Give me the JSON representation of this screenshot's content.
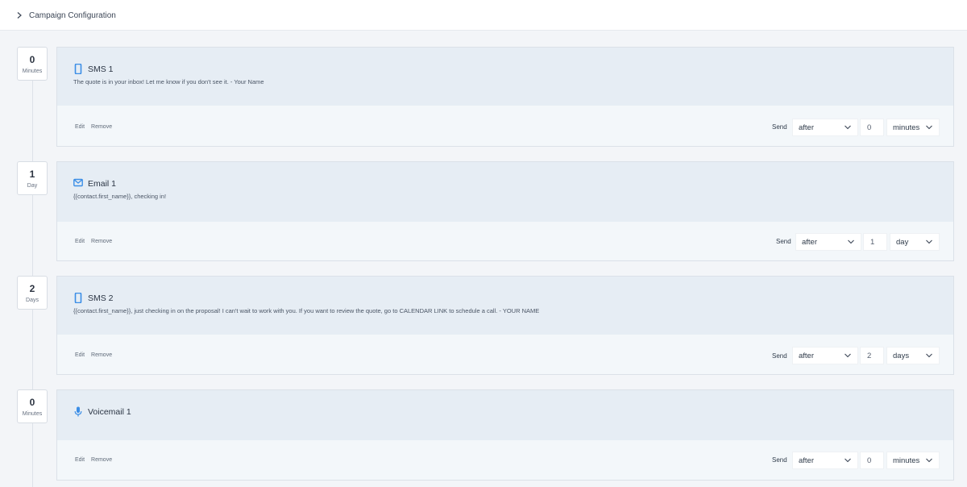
{
  "header": {
    "title": "Campaign Configuration"
  },
  "steps": [
    {
      "delay_value": "0",
      "delay_unit": "Minutes",
      "type_icon": "phone-icon",
      "name": "SMS 1",
      "message": "The quote is in your inbox! Let me know if you don't see it.   - Your Name",
      "edit_label": "Edit",
      "remove_label": "Remove",
      "send_label": "Send",
      "when": "after",
      "amount": "0",
      "unit": "minutes"
    },
    {
      "delay_value": "1",
      "delay_unit": "Day",
      "type_icon": "envelope-icon",
      "name": "Email 1",
      "message": "{{contact.first_name}}, checking in!",
      "edit_label": "Edit",
      "remove_label": "Remove",
      "send_label": "Send",
      "when": "after",
      "amount": "1",
      "unit": "day"
    },
    {
      "delay_value": "2",
      "delay_unit": "Days",
      "type_icon": "phone-icon",
      "name": "SMS 2",
      "message": "{{contact.first_name}}, just checking in on the proposal! I can't wait to work with you. If you want to review the quote, go to CALENDAR LINK to schedule a call.    - YOUR NAME",
      "edit_label": "Edit",
      "remove_label": "Remove",
      "send_label": "Send",
      "when": "after",
      "amount": "2",
      "unit": "days"
    },
    {
      "delay_value": "0",
      "delay_unit": "Minutes",
      "type_icon": "microphone-icon",
      "name": "Voicemail 1",
      "message": "",
      "edit_label": "Edit",
      "remove_label": "Remove",
      "send_label": "Send",
      "when": "after",
      "amount": "0",
      "unit": "minutes"
    }
  ],
  "colors": {
    "accent": "#3b8ee6",
    "card_head": "#e6edf4",
    "card_body": "#f3f7fa"
  }
}
